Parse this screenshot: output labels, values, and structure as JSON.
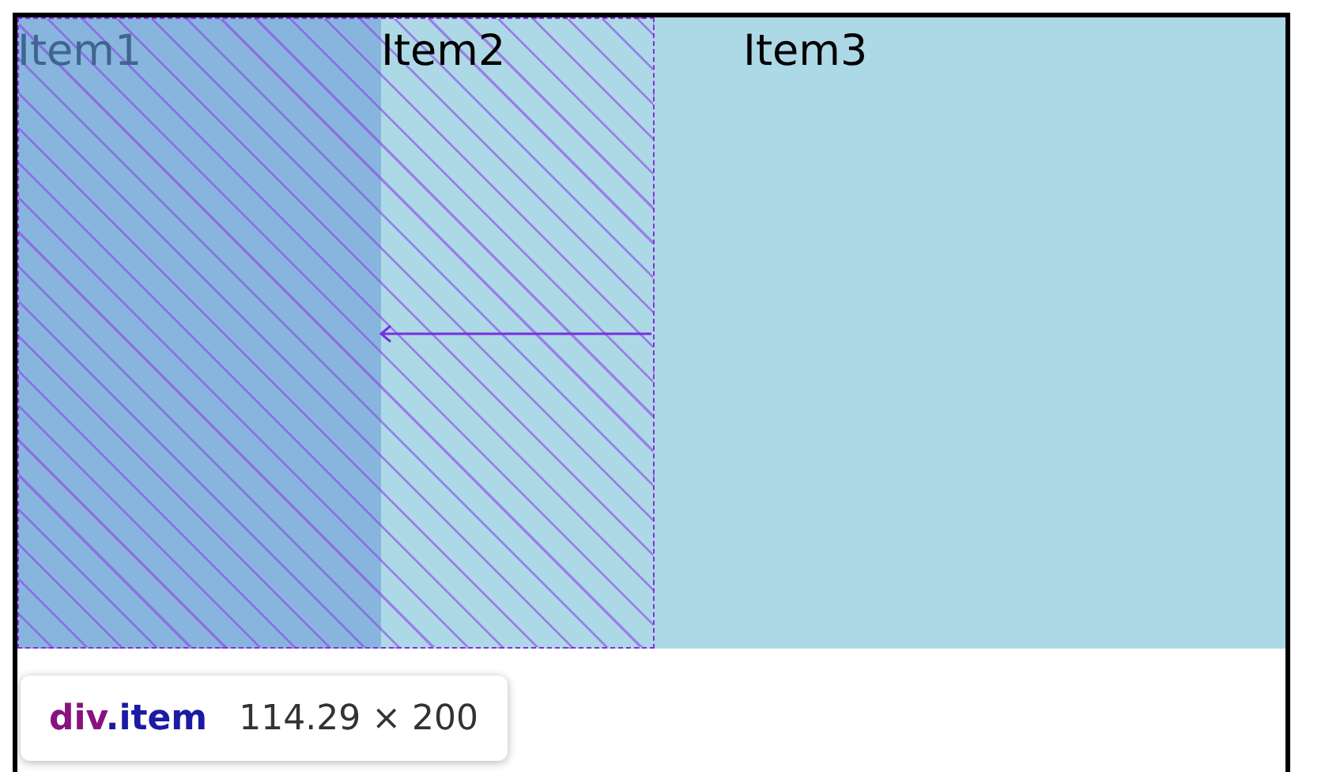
{
  "items": [
    {
      "label": "Item1",
      "selected": true
    },
    {
      "label": "Item2",
      "selected": false
    },
    {
      "label": "Item3",
      "selected": false
    }
  ],
  "tooltip": {
    "tag": "div",
    "class_name": ".item",
    "size": "114.29 × 200"
  }
}
